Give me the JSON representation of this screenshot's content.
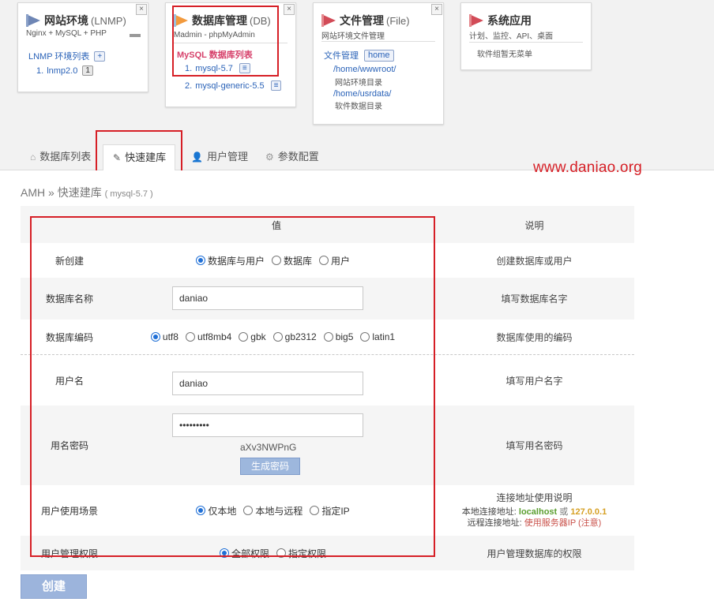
{
  "cards": {
    "lnmp": {
      "title": "网站环境",
      "title_sub": "(LNMP)",
      "subtitle": "Nginx + MySQL + PHP",
      "link": "LNMP 环境列表",
      "plus": "+",
      "items": [
        {
          "num": "1.",
          "label": "lnmp2.0",
          "badge": "1"
        }
      ]
    },
    "db": {
      "title": "数据库管理",
      "title_sub": "(DB)",
      "subtitle": "Madmin - phpMyAdmin",
      "section": "MySQL 数据库列表",
      "items": [
        {
          "num": "1.",
          "label": "mysql-5.7",
          "badge": "≡"
        },
        {
          "num": "2.",
          "label": "mysql-generic-5.5",
          "badge": "≡"
        }
      ]
    },
    "file": {
      "title": "文件管理",
      "title_sub": "(File)",
      "subtitle": "网站环境文件管理",
      "link": "文件管理",
      "home": "home",
      "paths": [
        {
          "path": "/home/wwwroot/",
          "desc": "网站环境目录"
        },
        {
          "path": "/home/usrdata/",
          "desc": "软件数据目录"
        }
      ]
    },
    "sys": {
      "title": "系统应用",
      "subtitle": "计划、监控、API、桌面",
      "note": "软件组暂无菜单"
    },
    "close": "×"
  },
  "tabs": [
    {
      "label": "数据库列表",
      "icon": "home-icon"
    },
    {
      "label": "快速建库",
      "icon": "pencil-icon"
    },
    {
      "label": "用户管理",
      "icon": "user-icon"
    },
    {
      "label": "参数配置",
      "icon": "gear-icon"
    }
  ],
  "watermark": "www.daniao.org",
  "breadcrumb": {
    "root": "AMH",
    "sep": "»",
    "page": "快速建库",
    "sub": "( mysql-5.7 )"
  },
  "table": {
    "header_value": "值",
    "header_desc": "说明",
    "rows": {
      "create_new": {
        "label": "新创建",
        "options": [
          "数据库与用户",
          "数据库",
          "用户"
        ],
        "selected": "数据库与用户",
        "desc": "创建数据库或用户"
      },
      "db_name": {
        "label": "数据库名称",
        "value": "daniao",
        "desc": "填写数据库名字"
      },
      "encoding": {
        "label": "数据库编码",
        "options": [
          "utf8",
          "utf8mb4",
          "gbk",
          "gb2312",
          "big5",
          "latin1"
        ],
        "selected": "utf8",
        "desc": "数据库使用的编码"
      },
      "username": {
        "label": "用户名",
        "value": "daniao",
        "desc": "填写用户名字"
      },
      "password": {
        "label": "用名密码",
        "value": "•••••••••",
        "generated": "aXv3NWPnG",
        "gen_button": "生成密码",
        "desc": "填写用名密码"
      },
      "scene": {
        "label": "用户使用场景",
        "options": [
          "仅本地",
          "本地与远程",
          "指定IP"
        ],
        "selected": "仅本地",
        "desc_title": "连接地址使用说明",
        "local_label": "本地连接地址:",
        "local_value": "localhost",
        "or": "或",
        "local_ip": "127.0.0.1",
        "remote_label": "远程连接地址:",
        "remote_value": "使用服务器IP (注意)"
      },
      "perm": {
        "label": "用户管理权限",
        "options": [
          "全部权限",
          "指定权限"
        ],
        "selected": "全部权限",
        "desc": "用户管理数据库的权限"
      }
    }
  },
  "create_button": "创建",
  "colors": {
    "accent": "#2b63b8",
    "highlight_red": "#d61f26",
    "button": "#9cb4dc"
  }
}
